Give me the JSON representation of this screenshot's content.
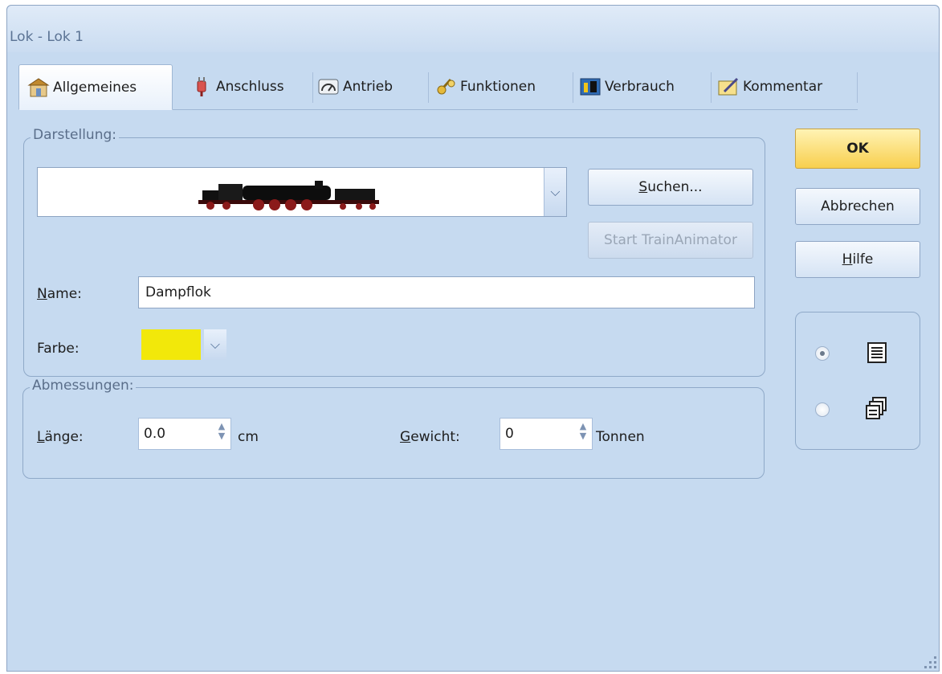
{
  "window": {
    "title": "Lok - Lok 1"
  },
  "tabs": [
    {
      "label": "Allgemeines",
      "icon": "general-icon",
      "active": true
    },
    {
      "label": "Anschluss",
      "icon": "plug-icon",
      "active": false
    },
    {
      "label": "Antrieb",
      "icon": "gauge-icon",
      "active": false
    },
    {
      "label": "Funktionen",
      "icon": "keys-icon",
      "active": false
    },
    {
      "label": "Verbrauch",
      "icon": "consumption-icon",
      "active": false
    },
    {
      "label": "Kommentar",
      "icon": "note-icon",
      "active": false
    }
  ],
  "darstellung": {
    "group_label": "Darstellung:",
    "image_name": "locomotive-image",
    "search_button_prefix": "S",
    "search_button_rest": "uchen...",
    "animator_button": "Start TrainAnimator",
    "name_label_prefix": "N",
    "name_label_rest": "ame:",
    "name_value": "Dampflok",
    "color_label": "Farbe:",
    "color_value": "#f2e80a"
  },
  "abmessungen": {
    "group_label": "Abmessungen:",
    "length_label_prefix": "L",
    "length_label_rest": "änge:",
    "length_value": "0.0",
    "length_unit": "cm",
    "weight_label_prefix": "G",
    "weight_label_rest": "ewicht:",
    "weight_value": "0",
    "weight_unit": "Tonnen"
  },
  "buttons": {
    "ok": "OK",
    "cancel": "Abbrechen",
    "help_prefix": "H",
    "help_rest": "ilfe"
  },
  "view_mode": {
    "options": [
      {
        "icon": "list-view-icon",
        "selected": true
      },
      {
        "icon": "multi-window-icon",
        "selected": false
      }
    ]
  },
  "colors": {
    "window_bg": "#c6daf0",
    "ok_button": "#f8cf4e"
  }
}
